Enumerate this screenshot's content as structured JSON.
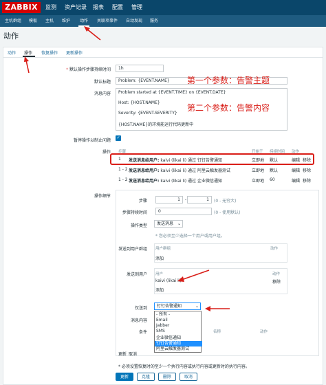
{
  "nav": {
    "logo": "ZABBIX",
    "top": [
      "监测",
      "资产记录",
      "报表",
      "配置",
      "管理"
    ],
    "sub": [
      "主机群组",
      "模板",
      "主机",
      "维护",
      "动作",
      "关联项事件",
      "自动发现",
      "服务"
    ]
  },
  "page_title": "动作",
  "tabs": [
    "动作",
    "操作",
    "恢复操作",
    "更新操作"
  ],
  "form": {
    "default_step_duration_label": "默认操作步骤持续时间",
    "default_step_duration_value": "1h",
    "subject_label": "默认标题",
    "subject_value": "Problem: {EVENT.NAME}",
    "message_label": "消息内容",
    "message_lines": [
      "Problem started at {EVENT.TIME} on {EVENT.DATE}",
      "Host: {HOST.NAME}",
      "Severity: {EVENT.SEVERITY}",
      "{HOST.NAME}的环境能运行代码更新中"
    ],
    "pause_label": "暂停操作以制止问题",
    "operations_label": "操作",
    "op_headers": {
      "steps": "步骤",
      "start_in": "开始于",
      "duration": "持续时间",
      "action": "动作"
    },
    "op_rows": [
      {
        "steps": "1",
        "details_bold": "发送消息给用户:",
        "details": "kaivi (likai li) 通过 钉钉告警通知",
        "start": "立即地",
        "duration": "默认",
        "edit": "编辑",
        "remove": "移除"
      },
      {
        "steps": "1 - 2",
        "details_bold": "发送消息给用户:",
        "details": "kaivi (likai li) 通过 阿里云触发器测试",
        "start": "立即地",
        "duration": "默认",
        "edit": "编辑",
        "remove": "移除"
      },
      {
        "steps": "1 - 2",
        "details_bold": "发送消息给用户:",
        "details": "kaivi (likai li) 通过 企业微信通知",
        "start": "立即地",
        "duration": "60",
        "edit": "编辑",
        "remove": "移除"
      }
    ],
    "op_details_label": "操作细节",
    "steps_label": "步骤",
    "steps_from": "1",
    "steps_to": "1",
    "steps_hint": "(0 - 无穷大)",
    "step_duration_label": "步骤持续时间",
    "step_duration_value": "0",
    "step_duration_hint": "(0 - 使用默认)",
    "op_type_label": "操作类型",
    "op_type_value": "发送消息",
    "must_select_hint": "* 您必须至少选择一个用户或用户组。",
    "send_groups_label": "发送到用户群组",
    "user_group_col": "用户群组",
    "action_col": "动作",
    "add_link": "添加",
    "send_users_label": "发送到用户",
    "user_col": "用户",
    "user_value": "kaivi (likai li)",
    "remove_link": "移除",
    "send_via_label": "仅送到",
    "send_via_value": "钉钉告警通知",
    "send_via_options": [
      "- 所有 -",
      "Email",
      "Jabber",
      "SMS",
      "企业微信通知",
      "钉钉告警通知",
      "阿里云触发器测试"
    ],
    "default_msg_label": "消息内容",
    "conditions_label": "条件",
    "name_col": "名称",
    "update_link": "更新",
    "cancel_link": "取消",
    "footer_hint": "* 必须设置恢复时的至少一个执行内容或执行内容或更新时的执行内容。"
  },
  "buttons": {
    "update": "更新",
    "clone": "克隆",
    "delete": "删除",
    "cancel": "取消"
  },
  "annotations": {
    "subject": "第一个参数：告警主题",
    "message": "第二个参数：告警内容"
  },
  "colors": {
    "topnav": "#0a466a",
    "subnav": "#1e5b80",
    "link": "#1f6c9c",
    "annotation": "#d91e18",
    "primary": "#0275b8"
  }
}
